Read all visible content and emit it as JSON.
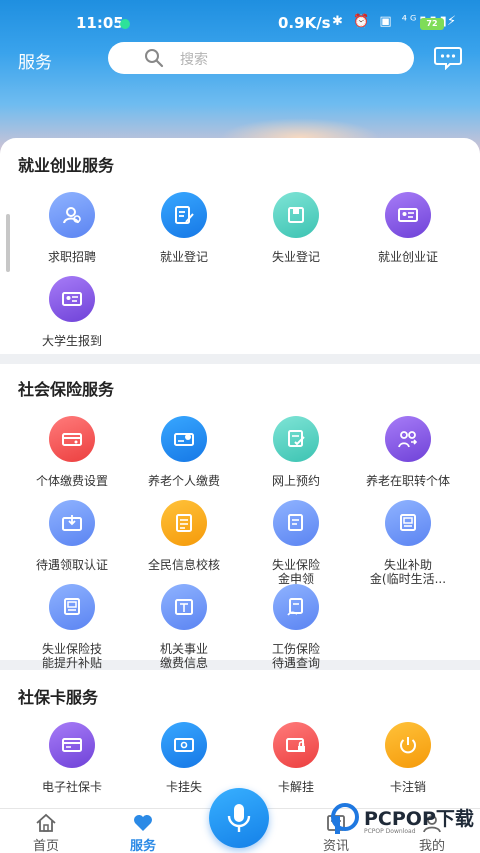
{
  "status_bar": {
    "time": "11:05",
    "speed": "0.9K/s",
    "icons": "✱ ⏰ ▣ ⁴ᴳ▮▮▮",
    "battery": "72"
  },
  "header": {
    "title": "服务",
    "search_placeholder": "搜索"
  },
  "sections": [
    {
      "title": "就业创业服务",
      "items": [
        "求职招聘",
        "就业登记",
        "失业登记",
        "就业创业证",
        "大学生报到"
      ]
    },
    {
      "title": "社会保险服务",
      "items": [
        "个体缴费设置",
        "养老个人缴费",
        "网上预约",
        "养老在职转个体",
        "待遇领取认证",
        "全民信息校核",
        "失业保险",
        "金申领",
        "失业补助",
        "金(临时生活...",
        "失业保险技",
        "能提升补贴",
        "机关事业",
        "缴费信息",
        "工伤保险",
        "待遇查询"
      ]
    },
    {
      "title": "社保卡服务",
      "items": [
        "电子社保卡",
        "卡挂失",
        "卡解挂",
        "卡注销"
      ]
    }
  ],
  "tabbar": {
    "home": "首页",
    "service": "服务",
    "news": "资讯",
    "mine": "我的"
  },
  "watermark": {
    "brand": "PCPOP下载",
    "sub": "PCPOP Download"
  },
  "colors": {
    "accent": "#2b8ae6",
    "purple": "#6f42d8",
    "red": "#ec3f3f",
    "orange": "#f59a0a",
    "teal": "#3cc3b2"
  }
}
